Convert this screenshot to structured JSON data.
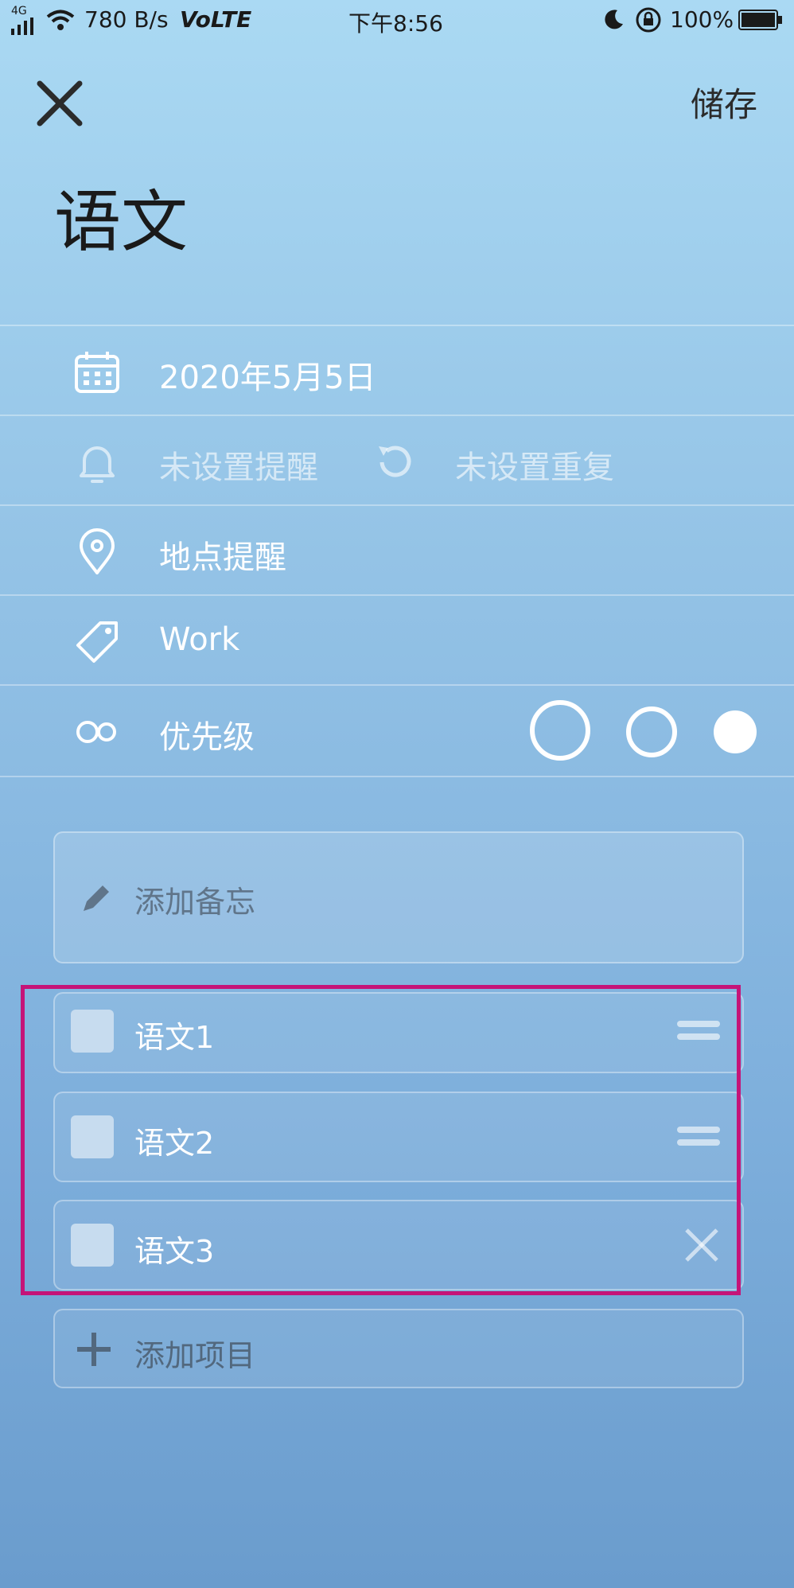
{
  "status_bar": {
    "network": "4G",
    "speed": "780 B/s",
    "volte": "VoLTE",
    "time": "下午8:56",
    "battery": "100%"
  },
  "header": {
    "save_label": "储存",
    "title": "语文"
  },
  "rows": {
    "date": "2020年5月5日",
    "reminder": "未设置提醒",
    "repeat": "未设置重复",
    "location": "地点提醒",
    "tag": "Work",
    "priority": "优先级"
  },
  "note": {
    "placeholder": "添加备忘"
  },
  "items": [
    {
      "label": "语文1"
    },
    {
      "label": "语文2"
    },
    {
      "label": "语文3"
    }
  ],
  "add_item": {
    "placeholder": "添加项目"
  },
  "colors": {
    "highlight": "#c51478",
    "bg_top": "#aad9f3",
    "bg_bottom": "#6a9ccd"
  },
  "icons": [
    "close-icon",
    "calendar-icon",
    "bell-icon",
    "repeat-icon",
    "location-pin-icon",
    "tag-icon",
    "priority-icon",
    "pencil-icon",
    "drag-handle-icon",
    "delete-icon",
    "plus-icon"
  ]
}
